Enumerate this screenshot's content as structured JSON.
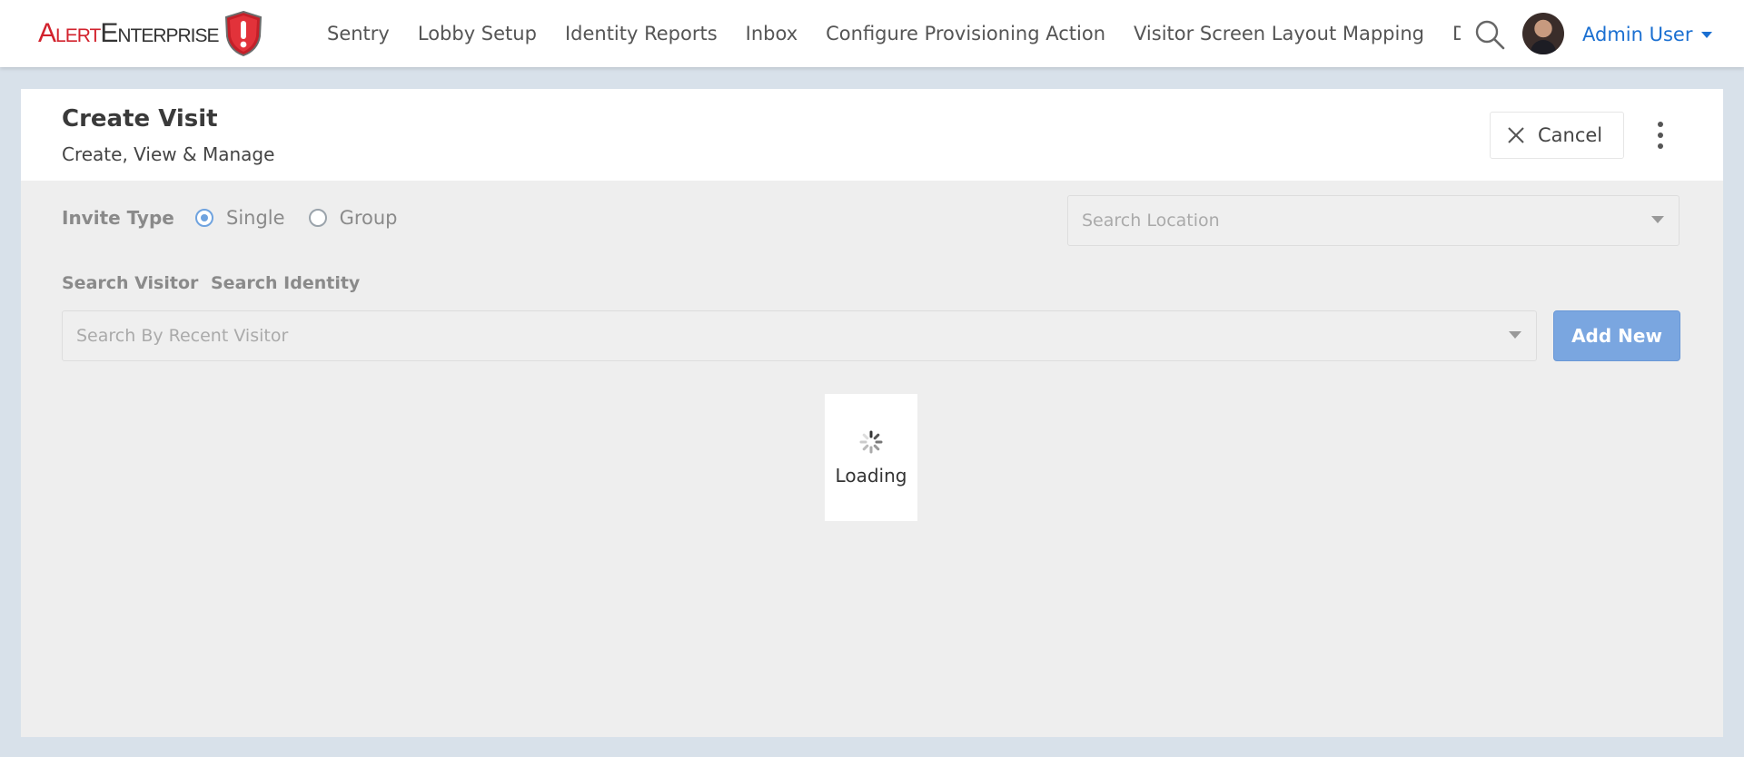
{
  "brand": {
    "logo_alert": "Alert",
    "logo_enterprise": "Enterprise"
  },
  "nav": {
    "items": [
      "Sentry",
      "Lobby Setup",
      "Identity Reports",
      "Inbox",
      "Configure Provisioning Action",
      "Visitor Screen Layout Mapping",
      "Dashboard"
    ],
    "search_icon": "search-icon"
  },
  "user": {
    "name": "Admin User"
  },
  "page": {
    "title": "Create Visit",
    "subtitle": "Create, View & Manage",
    "cancel_label": "Cancel",
    "more_icon": "more-vertical-icon"
  },
  "form": {
    "invite_type_label": "Invite Type",
    "invite_options": [
      {
        "label": "Single",
        "checked": true
      },
      {
        "label": "Group",
        "checked": false
      }
    ],
    "location_placeholder": "Search Location",
    "tabs": [
      "Search Visitor",
      "Search Identity"
    ],
    "visitor_placeholder": "Search By Recent Visitor",
    "add_new_label": "Add New"
  },
  "loading": {
    "text": "Loading"
  },
  "colors": {
    "brand_red": "#d2222d",
    "link_blue": "#1a6fd1",
    "primary_button": "#7aa6e0",
    "page_background": "#d8e1ea"
  }
}
